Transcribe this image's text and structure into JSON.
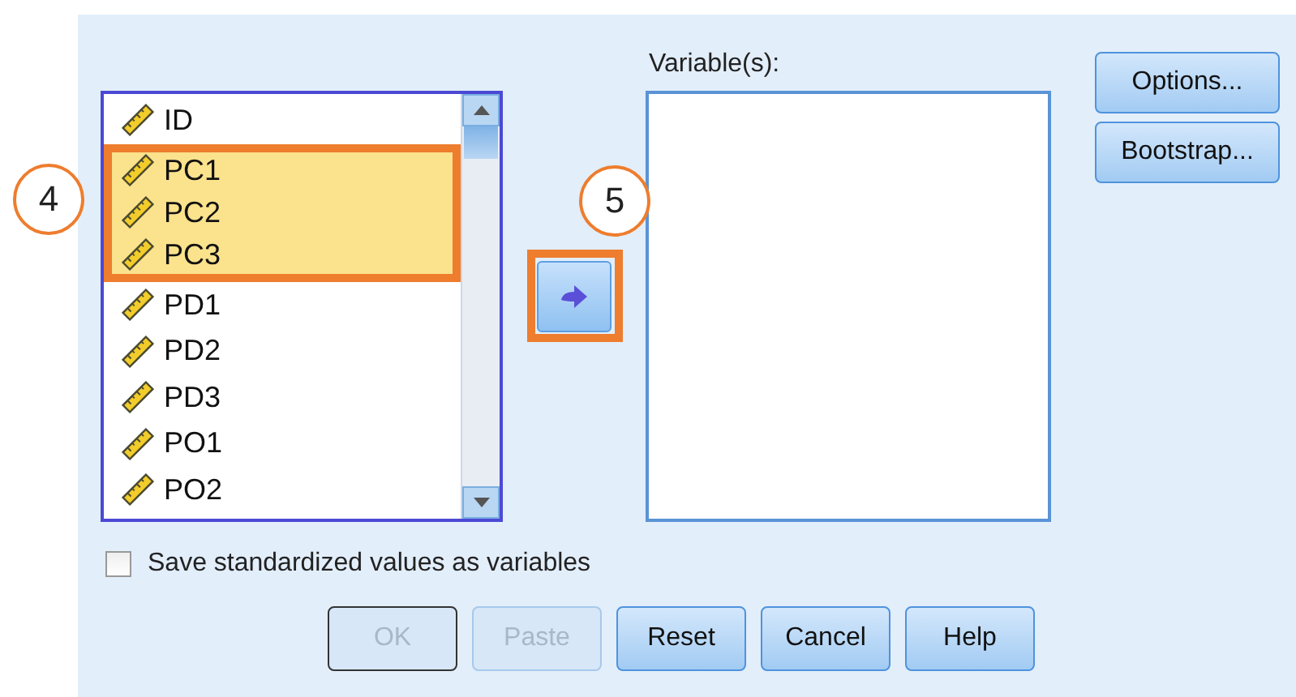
{
  "source_list": {
    "items": [
      {
        "label": "ID",
        "selected": false
      },
      {
        "label": "PC1",
        "selected": true
      },
      {
        "label": "PC2",
        "selected": true
      },
      {
        "label": "PC3",
        "selected": true
      },
      {
        "label": "PD1",
        "selected": false
      },
      {
        "label": "PD2",
        "selected": false
      },
      {
        "label": "PD3",
        "selected": false
      },
      {
        "label": "PO1",
        "selected": false
      },
      {
        "label": "PO2",
        "selected": false
      }
    ],
    "callout": "4"
  },
  "move_button": {
    "callout": "5"
  },
  "target": {
    "label": "Variable(s):"
  },
  "side_buttons": [
    {
      "label": "Options..."
    },
    {
      "label": "Bootstrap..."
    }
  ],
  "save_checkbox": {
    "label": "Save standardized values as variables",
    "checked": false
  },
  "buttons": [
    {
      "label": "OK",
      "disabled": true
    },
    {
      "label": "Paste",
      "disabled": true
    },
    {
      "label": "Reset",
      "disabled": false
    },
    {
      "label": "Cancel",
      "disabled": false
    },
    {
      "label": "Help",
      "disabled": false
    }
  ]
}
